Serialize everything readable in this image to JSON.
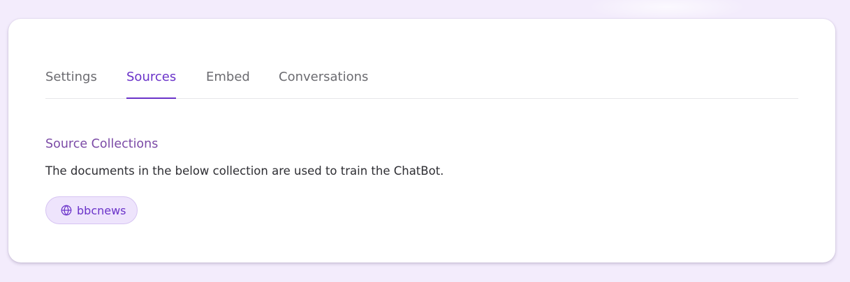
{
  "tabs": [
    {
      "label": "Settings",
      "active": false
    },
    {
      "label": "Sources",
      "active": true
    },
    {
      "label": "Embed",
      "active": false
    },
    {
      "label": "Conversations",
      "active": false
    }
  ],
  "sources": {
    "section_title": "Source Collections",
    "description": "The documents in the below collection are used to train the ChatBot.",
    "collections": [
      {
        "name": "bbcnews",
        "icon": "globe-icon"
      }
    ]
  },
  "colors": {
    "page_background": "#f3ecfc",
    "accent": "#6a32c9",
    "section_title": "#7b4aa6",
    "chip_background": "#eee4fc",
    "chip_border": "#d6c4f2"
  }
}
